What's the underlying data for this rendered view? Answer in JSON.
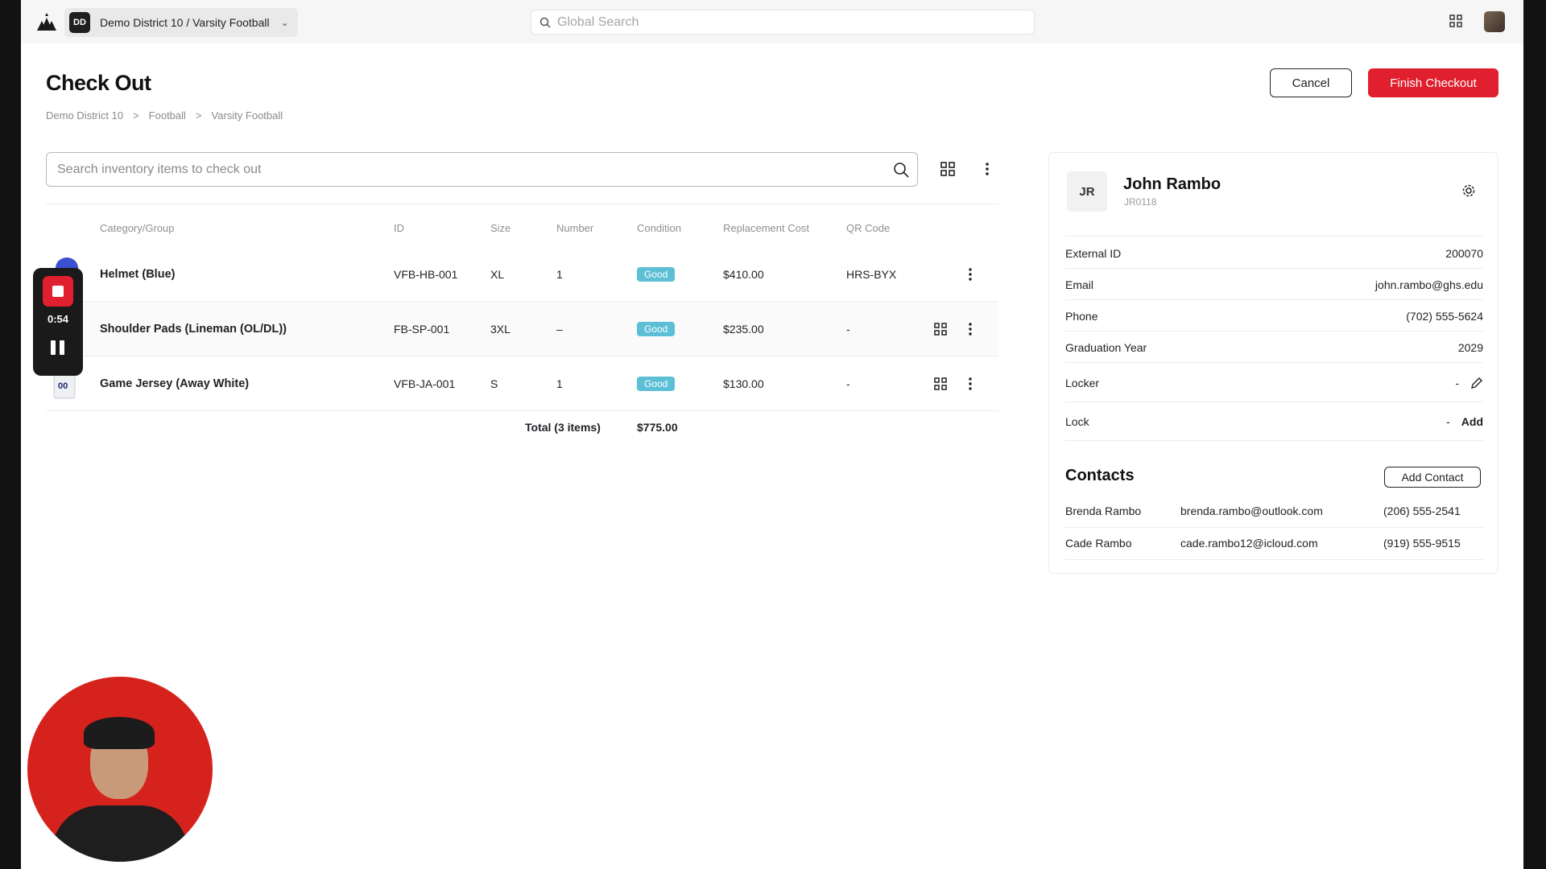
{
  "topbar": {
    "workspace_badge": "DD",
    "workspace_name": "Demo District 10 / Varsity Football",
    "global_search_placeholder": "Global Search"
  },
  "header": {
    "title": "Check Out",
    "breadcrumb": [
      "Demo District 10",
      ">",
      "Football",
      ">",
      "Varsity Football"
    ],
    "cancel_label": "Cancel",
    "finish_label": "Finish Checkout"
  },
  "inventory": {
    "search_placeholder": "Search inventory items to check out",
    "columns": [
      "Category/Group",
      "ID",
      "Size",
      "Number",
      "Condition",
      "Replacement Cost",
      "QR Code"
    ],
    "rows": [
      {
        "name": "Helmet (Blue)",
        "id": "VFB-HB-001",
        "size": "XL",
        "number": "1",
        "condition": "Good",
        "cost": "$410.00",
        "qr": "HRS-BYX"
      },
      {
        "name": "Shoulder Pads (Lineman (OL/DL))",
        "id": "FB-SP-001",
        "size": "3XL",
        "number": "–",
        "condition": "Good",
        "cost": "$235.00",
        "qr": "-"
      },
      {
        "name": "Game Jersey (Away White)",
        "id": "VFB-JA-001",
        "size": "S",
        "number": "1",
        "condition": "Good",
        "cost": "$130.00",
        "qr": "-"
      }
    ],
    "total_label": "Total (3 items)",
    "total_value": "$775.00"
  },
  "recorder": {
    "time": "0:54"
  },
  "profile": {
    "initials": "JR",
    "name": "John Rambo",
    "code": "JR0118",
    "fields": [
      {
        "label": "External ID",
        "value": "200070"
      },
      {
        "label": "Email",
        "value": "john.rambo@ghs.edu"
      },
      {
        "label": "Phone",
        "value": "(702) 555-5624"
      },
      {
        "label": "Graduation Year",
        "value": "2029"
      }
    ],
    "locker": {
      "label": "Locker",
      "value": "-"
    },
    "lock": {
      "label": "Lock",
      "value": "-",
      "action": "Add"
    },
    "contacts_title": "Contacts",
    "add_contact_label": "Add Contact",
    "contacts": [
      {
        "name": "Brenda Rambo",
        "email": "brenda.rambo@outlook.com",
        "phone": "(206) 555-2541"
      },
      {
        "name": "Cade Rambo",
        "email": "cade.rambo12@icloud.com",
        "phone": "(919) 555-9515"
      }
    ]
  },
  "colors": {
    "accent_red": "#e0202f",
    "good_badge": "#5cbfd6"
  }
}
